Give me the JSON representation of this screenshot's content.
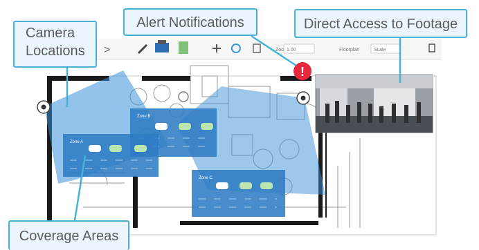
{
  "callouts": {
    "camera_locations": [
      "Camera",
      "Locations"
    ],
    "alert_notifications": "Alert Notifications",
    "direct_access": "Direct Access to Footage",
    "coverage_areas": "Coverage Areas"
  },
  "toolbar": {
    "back_glyph": ">",
    "zoom_label": "Zoom",
    "zoom_value": "1.00",
    "floorplan_label": "Floorplan",
    "floorplan_value": "Scale"
  },
  "alert": {
    "glyph": "!"
  },
  "panels": {
    "panel_a_title": "Zone A",
    "panel_b_title": "Zone B",
    "panel_c_title": "Zone C"
  },
  "icons": {
    "camera": "camera-icon",
    "alert": "alert-icon",
    "pen": "pen-icon",
    "printer": "printer-icon",
    "document": "document-icon",
    "move": "move-icon",
    "rotate": "rotate-icon",
    "fit": "fit-icon",
    "export": "export-icon"
  },
  "colors": {
    "callout_border": "#46b3d6",
    "callout_fill": "#eaf6fb",
    "coverage_fill": "#3b8fd8",
    "panel_fill": "#2f7cc4",
    "alert_red": "#e8283c",
    "wall": "#1a1a1a"
  }
}
